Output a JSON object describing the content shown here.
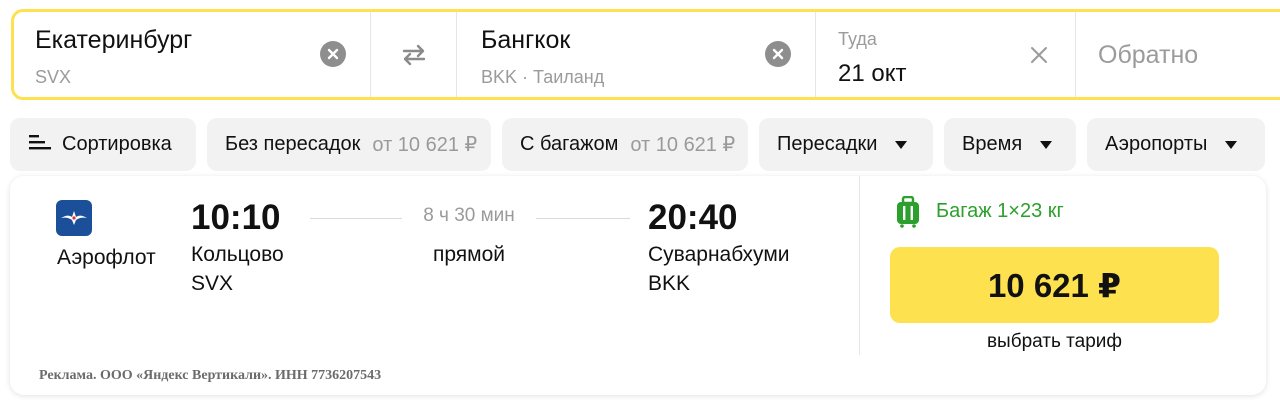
{
  "search": {
    "from": {
      "city": "Екатеринбург",
      "code": "SVX"
    },
    "to": {
      "city": "Бангкок",
      "code": "BKK · Таиланд"
    },
    "depart": {
      "label": "Туда",
      "value": "21 окт"
    },
    "return": {
      "placeholder": "Обратно"
    }
  },
  "filters": {
    "sort_label": "Сортировка",
    "nonstop": {
      "label": "Без пересадок",
      "price": "от 10 621 ₽"
    },
    "baggage": {
      "label": "С багажом",
      "price": "от 10 621 ₽"
    },
    "transfers_label": "Пересадки",
    "time_label": "Время",
    "airports_label": "Аэропорты"
  },
  "result": {
    "airline": "Аэрофлот",
    "departure": {
      "time": "10:10",
      "airport": "Кольцово",
      "code": "SVX"
    },
    "duration": "8 ч 30 мин",
    "stops": "прямой",
    "arrival": {
      "time": "20:40",
      "airport": "Суварнабхуми",
      "code": "BKK"
    },
    "baggage": "Багаж 1×23 кг",
    "price": "10 621 ₽",
    "select_fare": "выбрать тариф",
    "ad_note": "Реклама. ООО «Яндекс Вертикали». ИНН 7736207543"
  },
  "colors": {
    "accent_yellow": "#fde14e",
    "baggage_green": "#2ca02c",
    "aeroflot_blue": "#1b4f9a"
  }
}
